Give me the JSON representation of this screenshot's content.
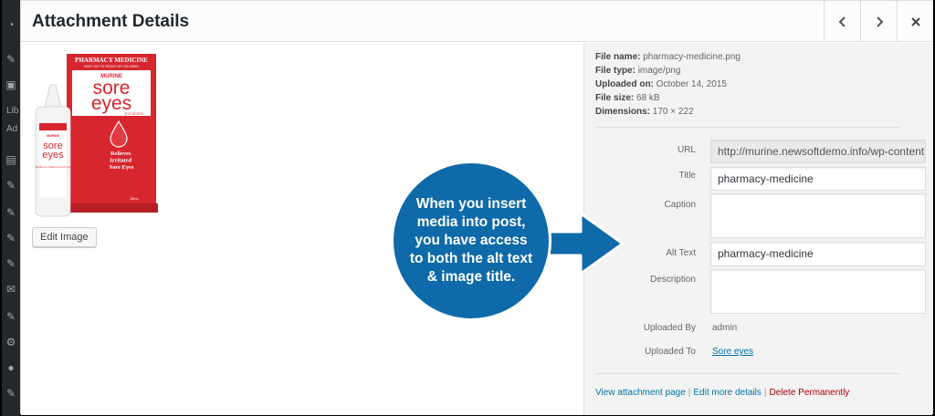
{
  "modal": {
    "title": "Attachment Details"
  },
  "sidebar": {
    "text_1": "Lib",
    "text_2": "Ad"
  },
  "image": {
    "alt": "pharmacy-medicine",
    "box_top": "PHARMACY MEDICINE",
    "box_sub": "KEEP OUT OF REACH OF CHILDREN",
    "brand": "MURINE",
    "product_1": "sore",
    "product_2": "eyes",
    "product_type": "EYE DROPS",
    "claim": "Relieves Irritated Sore Eyes",
    "bottle_brand": "MURINE",
    "bottle_product_1": "sore",
    "bottle_product_2": "eyes",
    "bottle_claim": "Relieves Irritated Sore Eyes",
    "volume": "15mL"
  },
  "edit_image_label": "Edit Image",
  "meta": {
    "file_name_label": "File name:",
    "file_name": "pharmacy-medicine.png",
    "file_type_label": "File type:",
    "file_type": "image/png",
    "uploaded_on_label": "Uploaded on:",
    "uploaded_on": "October 14, 2015",
    "file_size_label": "File size:",
    "file_size": "68 kB",
    "dimensions_label": "Dimensions:",
    "dimensions": "170 × 222"
  },
  "fields": {
    "url_label": "URL",
    "url_value": "http://murine.newsoftdemo.info/wp-content",
    "title_label": "Title",
    "title_value": "pharmacy-medicine",
    "caption_label": "Caption",
    "alt_label": "Alt Text",
    "alt_value": "pharmacy-medicine",
    "description_label": "Description",
    "uploaded_by_label": "Uploaded By",
    "uploaded_by": "admin",
    "uploaded_to_label": "Uploaded To",
    "uploaded_to": "Sore eyes"
  },
  "actions": {
    "view_page": "View attachment page",
    "edit_details": "Edit more details",
    "delete": "Delete Permanently",
    "separator": "|"
  },
  "callout": {
    "text": "When you insert media into post, you have access to both the alt text & image title."
  },
  "colors": {
    "accent": "#0073aa",
    "callout": "#0e6aa8",
    "danger": "#a00000",
    "brand_red": "#d8262f"
  }
}
